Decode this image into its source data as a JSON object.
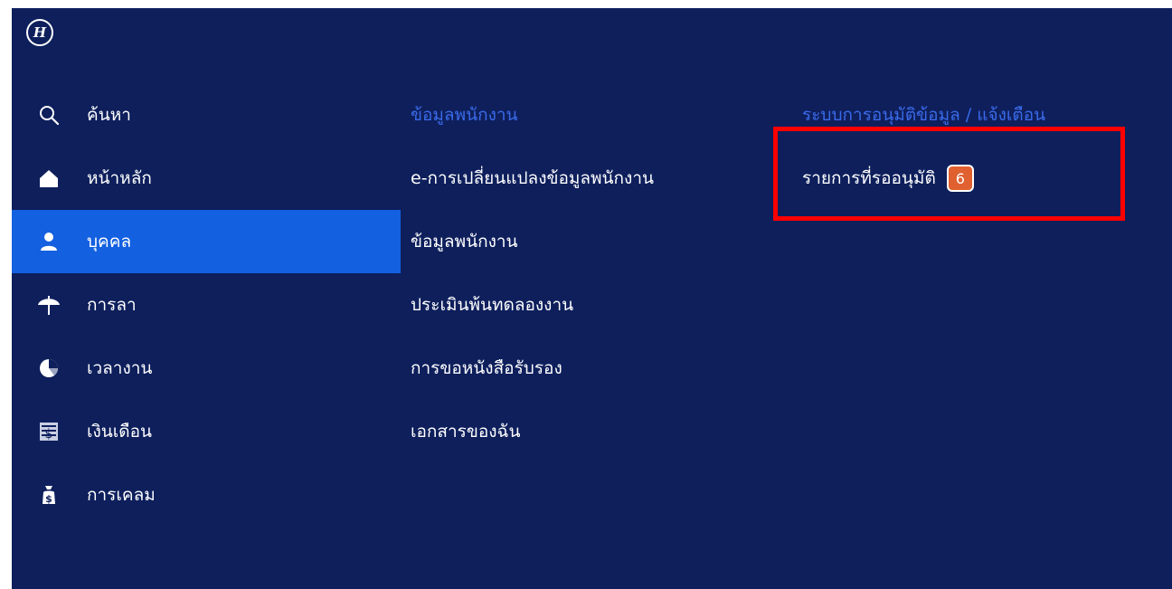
{
  "logo": {
    "text": "H"
  },
  "sidebar": {
    "items": [
      {
        "label": "ค้นหา",
        "icon": "search-icon",
        "active": false
      },
      {
        "label": "หน้าหลัก",
        "icon": "home-icon",
        "active": false
      },
      {
        "label": "บุคคล",
        "icon": "user-icon",
        "active": true
      },
      {
        "label": "การลา",
        "icon": "umbrella-icon",
        "active": false
      },
      {
        "label": "เวลางาน",
        "icon": "clock-icon",
        "active": false
      },
      {
        "label": "เงินเดือน",
        "icon": "salary-icon",
        "active": false
      },
      {
        "label": "การเคลม",
        "icon": "money-bag-icon",
        "active": false
      }
    ]
  },
  "employee_column": {
    "header": "ข้อมูลพนักงาน",
    "links": [
      "e-การเปลี่ยนแปลงข้อมูลพนักงาน",
      "ข้อมูลพนักงาน",
      "ประเมินพ้นทดลองงาน",
      "การขอหนังสือรับรอง",
      "เอกสารของฉัน"
    ]
  },
  "approval_column": {
    "header": "ระบบการอนุมัติข้อมูล / แจ้งเตือน",
    "links": [
      {
        "label": "รายการที่รออนุมัติ",
        "badge": "6"
      }
    ]
  },
  "colors": {
    "background": "#0e1f5c",
    "active": "#1360e0",
    "header": "#3a6ae8",
    "badge": "#e06030",
    "highlight": "#ff0000"
  }
}
